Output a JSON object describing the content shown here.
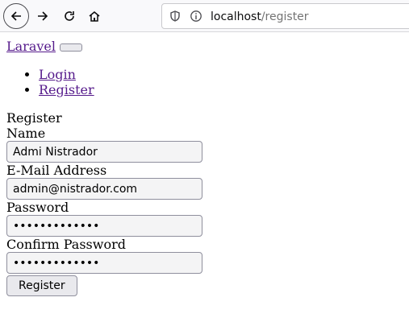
{
  "browser": {
    "url_host": "localhost",
    "url_path": "/register"
  },
  "nav": {
    "brand": "Laravel",
    "links": [
      "Login",
      "Register"
    ]
  },
  "form": {
    "title": "Register",
    "name_label": "Name",
    "name_value": "Admi Nistrador",
    "email_label": "E-Mail Address",
    "email_value": "admin@nistrador.com",
    "password_label": "Password",
    "password_value": "adminpassword",
    "confirm_label": "Confirm Password",
    "confirm_value": "adminpassword",
    "submit_label": "Register"
  }
}
